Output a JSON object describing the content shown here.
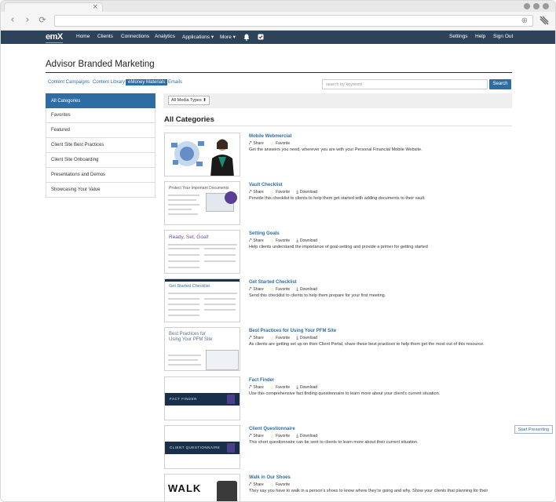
{
  "browser": {
    "back_glyph": "‹",
    "forward_glyph": "›",
    "reload_glyph": "⟳",
    "tab_close_glyph": "×",
    "globe_glyph": "⊕"
  },
  "nav": {
    "logo": "emX",
    "items": [
      "Home",
      "Clients",
      "Connections",
      "Analytics",
      "Applications ▾",
      "More ▾"
    ],
    "right_items": [
      "Settings",
      "Help",
      "Sign Out"
    ]
  },
  "page": {
    "title": "Advisor Branded Marketing",
    "tabs": [
      "Content Campaigns",
      "Content Library",
      "eMoney Materials",
      "Emails"
    ],
    "active_tab": "eMoney Materials",
    "search_placeholder": "search by keyword",
    "search_button": "Search",
    "filter_select": "All Media Types",
    "section_title": "All Categories",
    "start_presenting": "Start Presenting"
  },
  "sidebar": {
    "items": [
      "All Categories",
      "Favorites",
      "Featured",
      "Client Site Best Practices",
      "Client Site Onboarding",
      "Presentations and Demos",
      "Showcasing Your Value"
    ],
    "active": "All Categories"
  },
  "labels": {
    "share": "Share",
    "favorite": "Favorite",
    "download": "Download"
  },
  "items": [
    {
      "title": "Mobile Webmercial",
      "desc": "Get the answers you need, wherever you are with your Personal Financial Mobile Website.",
      "has_download": false
    },
    {
      "title": "Vault Checklist",
      "desc": "Provide this checklist to clients to help them get started with adding documents to their vault.",
      "has_download": true,
      "thumb_heading": "Protect Your Important Documents"
    },
    {
      "title": "Setting Goals",
      "desc": "Help clients understand the importance of goal-setting and provide a primer for getting started",
      "has_download": true,
      "thumb_heading": "Ready, Set, Goal!"
    },
    {
      "title": "Get Started Checklist",
      "desc": "Send this checklist to clients to help them prepare for your first meeting.",
      "has_download": true,
      "thumb_heading": "Get Started Checklist"
    },
    {
      "title": "Best Practices for Using Your PFM Site",
      "desc": "As clients are getting set up on their Client Portal, share these best practices to help them get the most out of this resource.",
      "has_download": true,
      "thumb_heading": "Best Practices for Using Your PFM Site"
    },
    {
      "title": "Fact Finder",
      "desc": "Use this comprehensive fact finding questionnaire to learn more about your client's current situation.",
      "has_download": true,
      "thumb_label": "FACT FINDER"
    },
    {
      "title": "Client Questionnaire",
      "desc": "This short questionnaire can be sent to clients to learn more about their current situation.",
      "has_download": true,
      "thumb_label": "CLIENT QUESTIONNAIRE"
    },
    {
      "title": "Walk in Our Shoes",
      "desc": "They say you have to walk in a person's shoes to know where they're going and why. Show your clients that planning for their",
      "has_download": false,
      "thumb_label": "WALK"
    }
  ],
  "colors": {
    "nav_bg": "#2c4359",
    "accent": "#2e6da4",
    "star": "#e2b93b"
  }
}
